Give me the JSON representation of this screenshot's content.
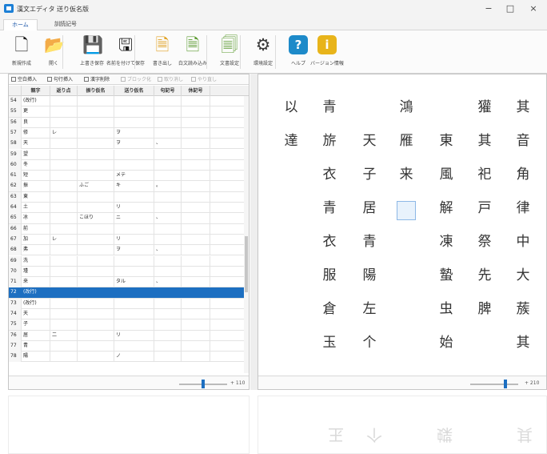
{
  "window": {
    "title": "漢文エディタ 送り仮名版",
    "minimize_glyph": "−",
    "maximize_glyph": "□",
    "close_glyph": "×"
  },
  "ribbon": {
    "tabs": [
      "ホーム",
      "訓読記号"
    ],
    "buttons": [
      {
        "label": "新規作成",
        "icon": "new-document-icon",
        "glyph": "🗋",
        "color": "#1a1a1a"
      },
      {
        "label": "開く",
        "icon": "open-folder-icon",
        "glyph": "📂",
        "color": "#d9a21b"
      },
      {
        "label": "上書き保存",
        "icon": "save-icon",
        "glyph": "💾",
        "color": "#1a1a1a"
      },
      {
        "label": "名前を付けて保存",
        "icon": "save-as-icon",
        "glyph": "🖫",
        "color": "#1a1a1a"
      },
      {
        "label": "書き出し",
        "icon": "export-icon",
        "glyph": "🗎",
        "color": "#e0a020"
      },
      {
        "label": "白文読み込み",
        "icon": "import-text-icon",
        "glyph": "🗎",
        "color": "#5a9a2e"
      },
      {
        "label": "文書設定",
        "icon": "document-settings-icon",
        "glyph": "🗐",
        "color": "#5a9a2e"
      },
      {
        "label": "環境設定",
        "icon": "gear-icon",
        "glyph": "⚙",
        "color": "#3a3a3a"
      },
      {
        "label": "ヘルプ",
        "icon": "help-icon",
        "glyph": "?",
        "color": "#1d8ac9"
      },
      {
        "label": "バージョン情報",
        "icon": "info-icon",
        "glyph": "i",
        "color": "#e8b41a"
      }
    ]
  },
  "grid_toolbar": {
    "items": [
      {
        "label": "空白挿入",
        "enabled": true
      },
      {
        "label": "句行挿入",
        "enabled": true
      },
      {
        "label": "漢字削除",
        "enabled": true
      },
      {
        "label": "ブロック化",
        "enabled": false
      },
      {
        "label": "取り消し",
        "enabled": false
      },
      {
        "label": "やり直し",
        "enabled": false
      }
    ]
  },
  "grid": {
    "columns": [
      "",
      "親字",
      "返り点",
      "振り仮名",
      "送り仮名",
      "句記号",
      "休記号"
    ],
    "rows": [
      {
        "no": "54",
        "kanji": "(改行)",
        "kaeri": "",
        "furi": "",
        "okuri": "",
        "kuki": "",
        "yasu": ""
      },
      {
        "no": "55",
        "kanji": "更",
        "kaeri": "",
        "furi": "",
        "okuri": "",
        "kuki": "",
        "yasu": ""
      },
      {
        "no": "56",
        "kanji": "良",
        "kaeri": "",
        "furi": "",
        "okuri": "",
        "kuki": "",
        "yasu": ""
      },
      {
        "no": "57",
        "kanji": "修",
        "kaeri": "レ",
        "furi": "",
        "okuri": "ヲ",
        "kuki": "",
        "yasu": ""
      },
      {
        "no": "58",
        "kanji": "天",
        "kaeri": "",
        "furi": "",
        "okuri": "ヲ",
        "kuki": "、",
        "yasu": ""
      },
      {
        "no": "59",
        "kanji": "望",
        "kaeri": "",
        "furi": "",
        "okuri": "",
        "kuki": "",
        "yasu": ""
      },
      {
        "no": "60",
        "kanji": "冬",
        "kaeri": "",
        "furi": "",
        "okuri": "",
        "kuki": "",
        "yasu": ""
      },
      {
        "no": "61",
        "kanji": "短",
        "kaeri": "",
        "furi": "",
        "okuri": "メテ",
        "kuki": "",
        "yasu": ""
      },
      {
        "no": "62",
        "kanji": "振",
        "kaeri": "",
        "furi": "ふご",
        "okuri": "キ",
        "kuki": "。",
        "yasu": ""
      },
      {
        "no": "63",
        "kanji": "東",
        "kaeri": "",
        "furi": "",
        "okuri": "",
        "kuki": "",
        "yasu": ""
      },
      {
        "no": "64",
        "kanji": "土",
        "kaeri": "",
        "furi": "",
        "okuri": "リ",
        "kuki": "",
        "yasu": ""
      },
      {
        "no": "65",
        "kanji": "冰",
        "kaeri": "",
        "furi": "こほり",
        "okuri": "ニ",
        "kuki": "、",
        "yasu": ""
      },
      {
        "no": "66",
        "kanji": "前",
        "kaeri": "",
        "furi": "",
        "okuri": "",
        "kuki": "",
        "yasu": ""
      },
      {
        "no": "67",
        "kanji": "加",
        "kaeri": "レ",
        "furi": "",
        "okuri": "リ",
        "kuki": "",
        "yasu": ""
      },
      {
        "no": "68",
        "kanji": "弗",
        "kaeri": "",
        "furi": "",
        "okuri": "ヲ",
        "kuki": "、",
        "yasu": ""
      },
      {
        "no": "69",
        "kanji": "洗",
        "kaeri": "",
        "furi": "",
        "okuri": "",
        "kuki": "",
        "yasu": ""
      },
      {
        "no": "70",
        "kanji": "瑾",
        "kaeri": "",
        "furi": "",
        "okuri": "",
        "kuki": "",
        "yasu": ""
      },
      {
        "no": "71",
        "kanji": "来",
        "kaeri": "",
        "furi": "",
        "okuri": "タル",
        "kuki": "、",
        "yasu": ""
      },
      {
        "no": "72",
        "kanji": "(改行)",
        "kaeri": "",
        "furi": "",
        "okuri": "",
        "kuki": "",
        "yasu": "",
        "selected": true
      },
      {
        "no": "73",
        "kanji": "(改行)",
        "kaeri": "",
        "furi": "",
        "okuri": "",
        "kuki": "",
        "yasu": ""
      },
      {
        "no": "74",
        "kanji": "天",
        "kaeri": "",
        "furi": "",
        "okuri": "",
        "kuki": "",
        "yasu": ""
      },
      {
        "no": "75",
        "kanji": "子",
        "kaeri": "",
        "furi": "",
        "okuri": "",
        "kuki": "",
        "yasu": ""
      },
      {
        "no": "76",
        "kanji": "居",
        "kaeri": "二",
        "furi": "",
        "okuri": "リ",
        "kuki": "",
        "yasu": ""
      },
      {
        "no": "77",
        "kanji": "青",
        "kaeri": "",
        "furi": "",
        "okuri": "",
        "kuki": "",
        "yasu": ""
      },
      {
        "no": "78",
        "kanji": "陽",
        "kaeri": "",
        "furi": "",
        "okuri": "ノ",
        "kuki": "",
        "yasu": ""
      }
    ]
  },
  "vertical_text": {
    "columns": [
      [
        "其",
        "音",
        "角",
        "律",
        "中",
        "大",
        "蔟",
        "其"
      ],
      [
        "獾",
        "其",
        "祀",
        "戸",
        "祭",
        "先",
        "脾"
      ],
      [
        "",
        "東",
        "風",
        "解",
        "凍",
        "蟄",
        "虫",
        "始"
      ],
      [
        "鴻",
        "雁",
        "来"
      ],
      [
        "",
        "天",
        "子",
        "居",
        "青",
        "陽",
        "左",
        "个"
      ],
      [
        "青",
        "旂",
        "衣",
        "青",
        "衣",
        "服",
        "倉",
        "玉"
      ],
      [
        "以",
        "達"
      ]
    ],
    "reflection": [
      "其",
      "蝶",
      "个",
      "玉"
    ]
  },
  "zoom": {
    "left_value": "+ 110",
    "right_value": "+ 210",
    "left_level": 0.5,
    "right_level": 0.75
  },
  "colors": {
    "selection": "#1d6fc1",
    "accent": "#1a56a8"
  }
}
